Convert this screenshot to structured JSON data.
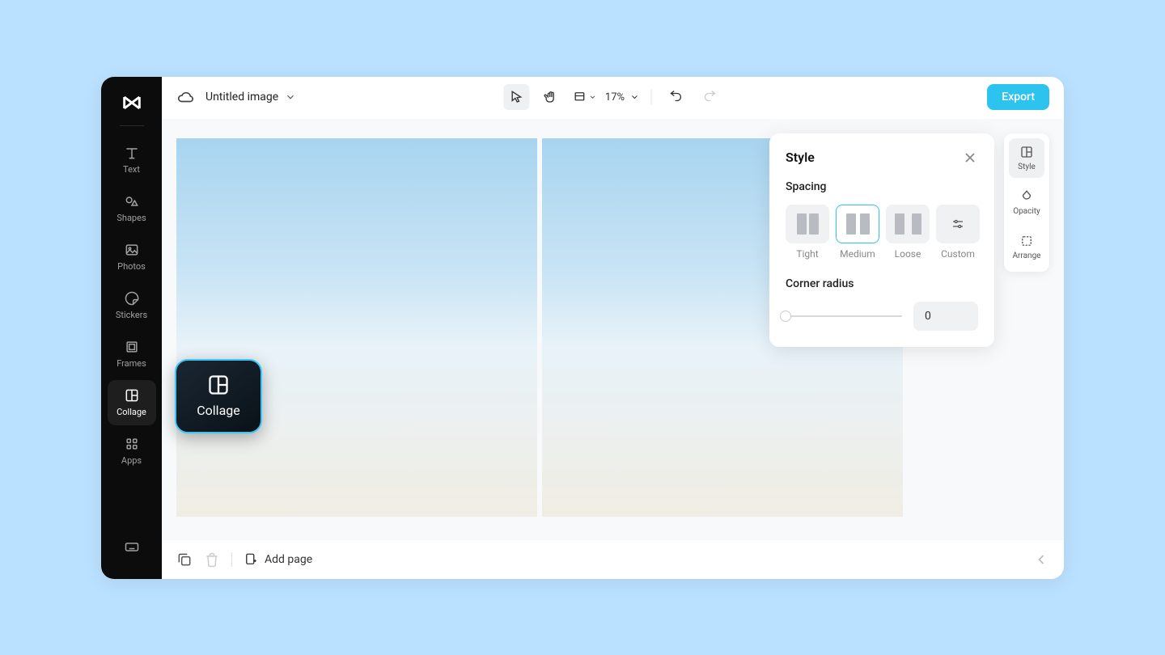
{
  "header": {
    "title": "Untitled image",
    "zoom": "17%",
    "export": "Export"
  },
  "sidebar": {
    "items": [
      {
        "label": "Text"
      },
      {
        "label": "Shapes"
      },
      {
        "label": "Photos"
      },
      {
        "label": "Stickers"
      },
      {
        "label": "Frames"
      },
      {
        "label": "Collage"
      },
      {
        "label": "Apps"
      }
    ]
  },
  "collage_badge": "Collage",
  "style_panel": {
    "title": "Style",
    "spacing_label": "Spacing",
    "spacing": [
      {
        "label": "Tight"
      },
      {
        "label": "Medium"
      },
      {
        "label": "Loose"
      },
      {
        "label": "Custom"
      }
    ],
    "corner_label": "Corner radius",
    "corner_value": "0"
  },
  "right_tools": [
    {
      "label": "Style"
    },
    {
      "label": "Opacity"
    },
    {
      "label": "Arrange"
    }
  ],
  "footer": {
    "add_page": "Add page"
  }
}
